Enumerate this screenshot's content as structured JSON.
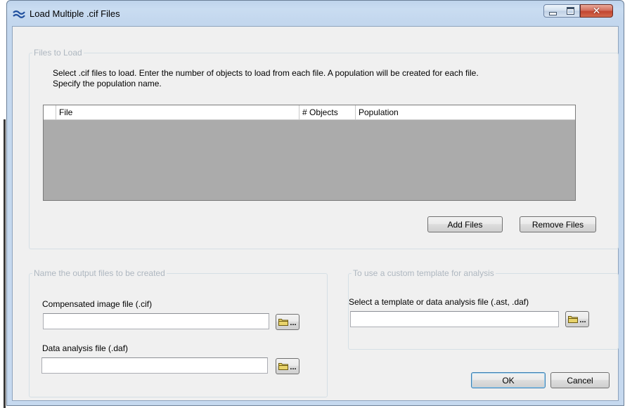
{
  "window": {
    "title": "Load Multiple .cif Files",
    "close_glyph": "✕"
  },
  "files_group": {
    "legend": "Files to Load",
    "instructions_line1": "Select .cif files to load.  Enter the number of objects to load from each file.  A population will be created for each file.",
    "instructions_line2": "Specify the population name.",
    "grid": {
      "columns": [
        "File",
        "# Objects",
        "Population"
      ],
      "rows": []
    },
    "add_label": "Add Files",
    "remove_label": "Remove Files"
  },
  "output_group": {
    "legend": "Name the output files to be created",
    "cif_label": "Compensated image file (.cif)",
    "cif_value": "",
    "daf_label": "Data analysis file (.daf)",
    "daf_value": "",
    "browse_dots": "..."
  },
  "template_group": {
    "legend": "To use a custom template for analysis",
    "select_label": "Select a template or data analysis file (.ast, .daf)",
    "template_value": "",
    "browse_dots": "..."
  },
  "dialog_buttons": {
    "ok": "OK",
    "cancel": "Cancel"
  },
  "icons": {
    "app": "wave-icon",
    "browse": "folder-icon"
  },
  "colors": {
    "title_bar": "#c3d7ee",
    "client_bg": "#f0f0f0",
    "group_legend": "#aeb7c0",
    "grid_bg": "#ababab",
    "close_button": "#c24530"
  }
}
